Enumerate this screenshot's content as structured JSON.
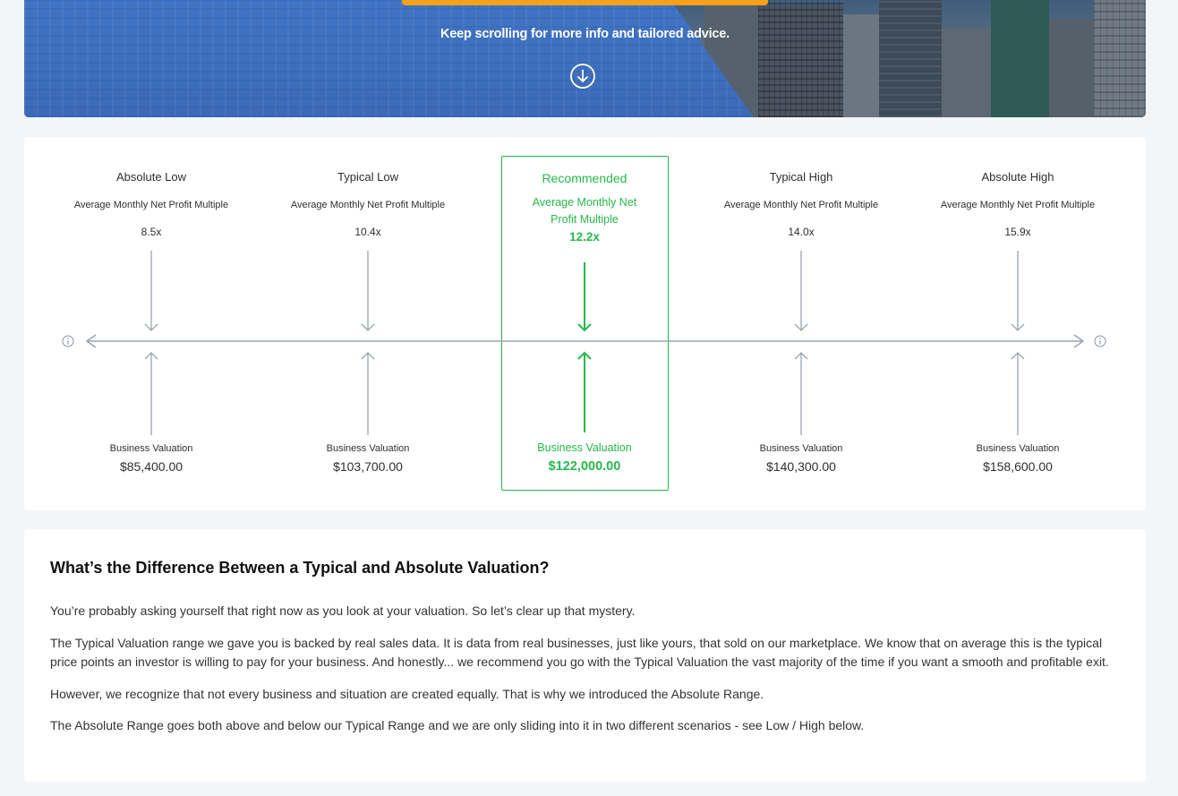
{
  "hero": {
    "scroll_text": "Keep scrolling for more info and tailored advice.",
    "scroll_icon": "arrow-down-circle-icon",
    "accent_color": "#f5a11b",
    "blue_color": "#3f74c7"
  },
  "valuation": {
    "accent_color": "#27b84a",
    "left_info_icon": "info-icon",
    "right_info_icon": "info-icon",
    "columns": [
      {
        "label": "Absolute Low",
        "metric": "Average Monthly Net Profit Multiple",
        "multiple": "8.5x",
        "bv_label": "Business Valuation",
        "bv_value": "$85,400.00"
      },
      {
        "label": "Typical Low",
        "metric": "Average Monthly Net Profit Multiple",
        "multiple": "10.4x",
        "bv_label": "Business Valuation",
        "bv_value": "$103,700.00"
      },
      {
        "label": "Recommended",
        "metric": "Average Monthly Net Profit Multiple",
        "multiple": "12.2x",
        "bv_label": "Business Valuation",
        "bv_value": "$122,000.00"
      },
      {
        "label": "Typical High",
        "metric": "Average Monthly Net Profit Multiple",
        "multiple": "14.0x",
        "bv_label": "Business Valuation",
        "bv_value": "$140,300.00"
      },
      {
        "label": "Absolute High",
        "metric": "Average Monthly Net Profit Multiple",
        "multiple": "15.9x",
        "bv_label": "Business Valuation",
        "bv_value": "$158,600.00"
      }
    ]
  },
  "explainer": {
    "title": "What’s the Difference Between a Typical and Absolute Valuation?",
    "paragraphs": [
      "You’re probably asking yourself that right now as you look at your valuation. So let’s clear up that mystery.",
      "The Typical Valuation range we gave you is backed by real sales data. It is data from real businesses, just like yours, that sold on our marketplace. We know that on average this is the typical price points an investor is willing to pay for your business. And honestly... we recommend you go with the Typical Valuation the vast majority of the time if you want a smooth and profitable exit.",
      "However, we recognize that not every business and situation are created equally. That is why we introduced the Absolute Range.",
      "The Absolute Range goes both above and below our Typical Range and we are only sliding into it in two different scenarios - see Low / High below."
    ]
  }
}
